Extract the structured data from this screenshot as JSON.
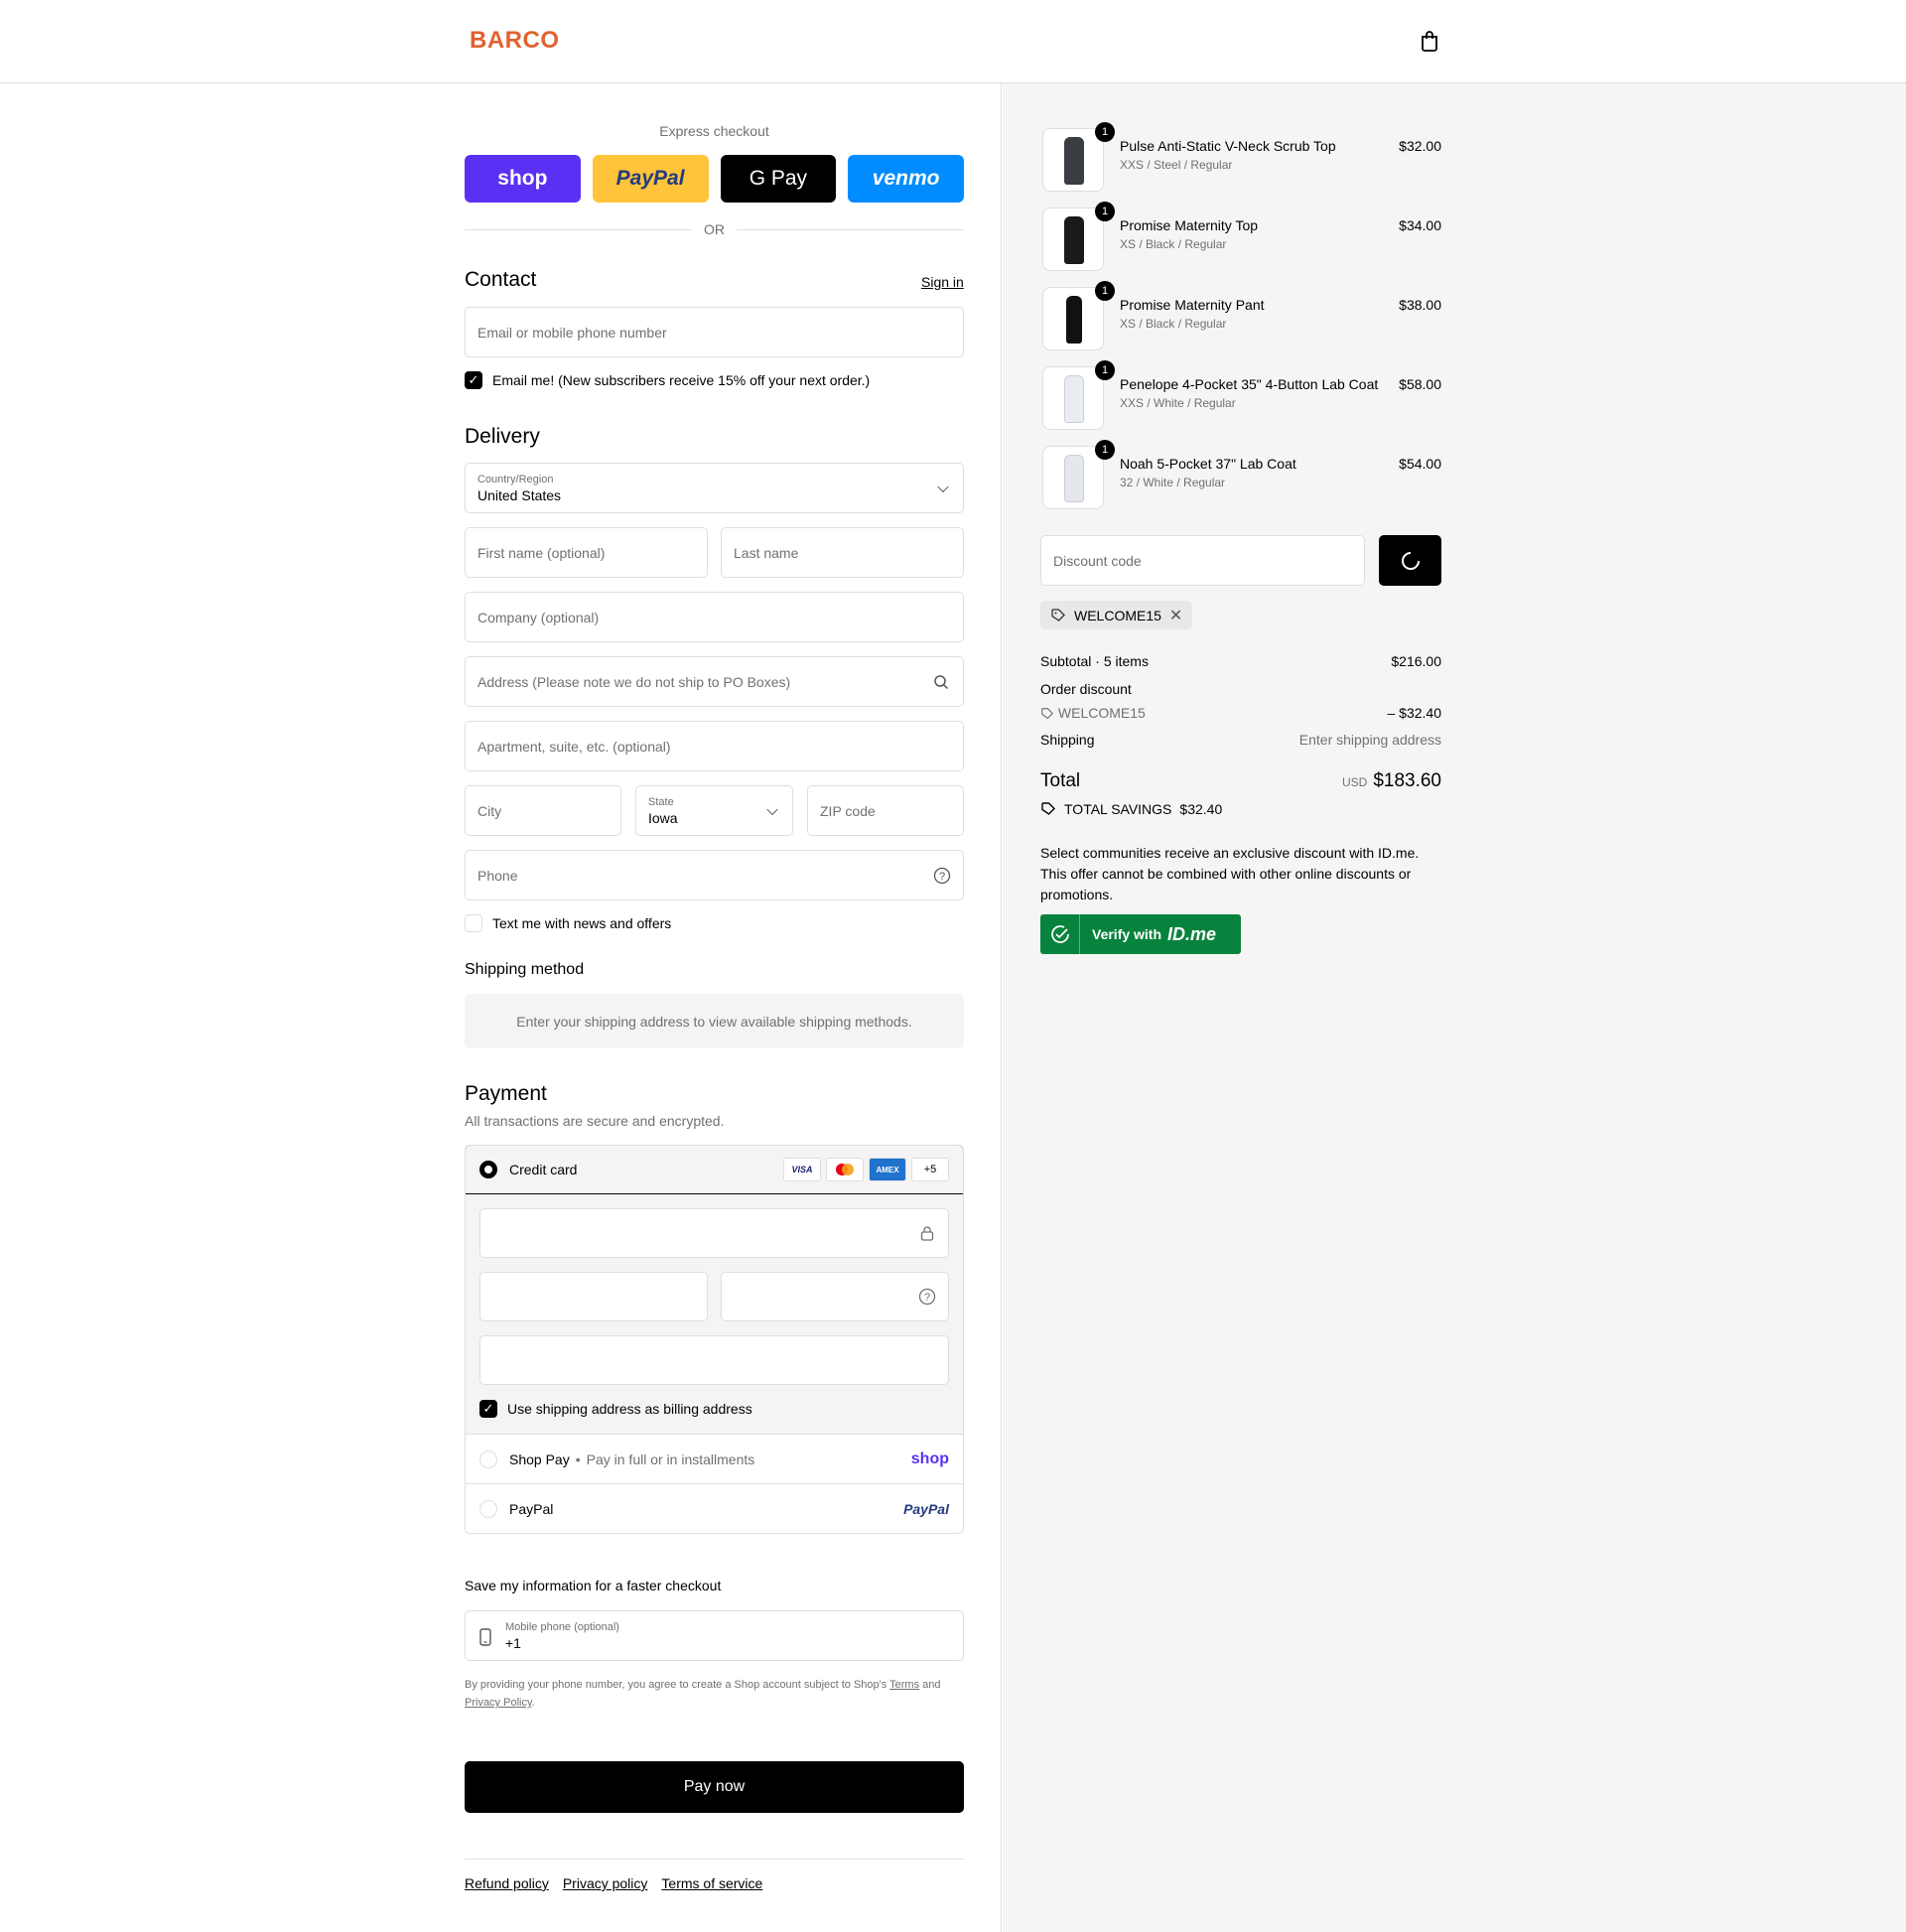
{
  "brand": {
    "name": "BARCO",
    "color": "#e0622f"
  },
  "header": {
    "cart_icon": "shopping-bag-icon"
  },
  "express": {
    "title": "Express checkout",
    "buttons": [
      {
        "label": "shop",
        "bg": "#5a31f4",
        "fg": "#ffffff"
      },
      {
        "label": "PayPal",
        "bg": "#ffc439",
        "fg": "#253b80"
      },
      {
        "label": "G Pay",
        "bg": "#000000",
        "fg": "#ffffff"
      },
      {
        "label": "venmo",
        "bg": "#008cff",
        "fg": "#ffffff"
      }
    ],
    "or": "OR"
  },
  "contact": {
    "heading": "Contact",
    "sign_in": "Sign in",
    "email_placeholder": "Email or mobile phone number",
    "email_me": "Email me! (New subscribers receive 15% off your next order.)"
  },
  "delivery": {
    "heading": "Delivery",
    "country_label": "Country/Region",
    "country_value": "United States",
    "first_name": "First name (optional)",
    "last_name": "Last name",
    "company": "Company (optional)",
    "address": "Address (Please note we do not ship to PO Boxes)",
    "apartment": "Apartment, suite, etc. (optional)",
    "city": "City",
    "state_label": "State",
    "state_value": "Iowa",
    "zip": "ZIP code",
    "phone": "Phone",
    "text_me": "Text me with news and offers"
  },
  "shipping": {
    "heading": "Shipping method",
    "notice": "Enter your shipping address to view available shipping methods."
  },
  "payment": {
    "heading": "Payment",
    "subtitle": "All transactions are secure and encrypted.",
    "credit_card": "Credit card",
    "cards": [
      "VISA",
      "MC",
      "AMEX",
      "+5"
    ],
    "billing_same": "Use shipping address as billing address",
    "shop_pay": "Shop Pay",
    "shop_pay_sub": "Pay in full or in installments",
    "shop_pay_logo": "shop",
    "paypal": "PayPal",
    "paypal_logo": "PayPal"
  },
  "save_info": {
    "heading": "Save my information for a faster checkout",
    "mobile_label": "Mobile phone (optional)",
    "mobile_value": "+1",
    "disclaimer_1": "By providing your phone number, you agree to create a Shop account subject to Shop's",
    "terms": "Terms",
    "and": "and",
    "privacy": "Privacy Policy",
    "period": "."
  },
  "pay_now": "Pay now",
  "footer": [
    "Refund policy",
    "Privacy policy",
    "Terms of service"
  ],
  "cart": {
    "items": [
      {
        "name": "Pulse Anti-Static V-Neck Scrub Top",
        "variant": "XXS / Steel / Regular",
        "price": "$32.00",
        "qty": "1",
        "color": "#3a3d42"
      },
      {
        "name": "Promise Maternity Top",
        "variant": "XS / Black / Regular",
        "price": "$34.00",
        "qty": "1",
        "color": "#1a1a1a"
      },
      {
        "name": "Promise Maternity Pant",
        "variant": "XS / Black / Regular",
        "price": "$38.00",
        "qty": "1",
        "color": "#111111"
      },
      {
        "name": "Penelope 4-Pocket 35\" 4-Button Lab Coat",
        "variant": "XXS / White / Regular",
        "price": "$58.00",
        "qty": "1",
        "color": "#e9edf2"
      },
      {
        "name": "Noah 5-Pocket 37\" Lab Coat",
        "variant": "32 / White / Regular",
        "price": "$54.00",
        "qty": "1",
        "color": "#e4e7ec"
      }
    ],
    "discount_placeholder": "Discount code",
    "applied_code": "WELCOME15",
    "subtotal_label": "Subtotal · 5 items",
    "subtotal": "$216.00",
    "order_discount_label": "Order discount",
    "discount_code": "WELCOME15",
    "discount_amount": "– $32.40",
    "shipping_label": "Shipping",
    "shipping_value": "Enter shipping address",
    "total_label": "Total",
    "currency": "USD",
    "total": "$183.60",
    "savings_label": "TOTAL SAVINGS",
    "savings": "$32.40",
    "idme_text": "Select communities receive an exclusive discount with ID.me. This offer cannot be combined with other online discounts or promotions.",
    "idme_btn": "Verify with",
    "idme_logo": "ID.me",
    "idme_color": "#08833d"
  }
}
